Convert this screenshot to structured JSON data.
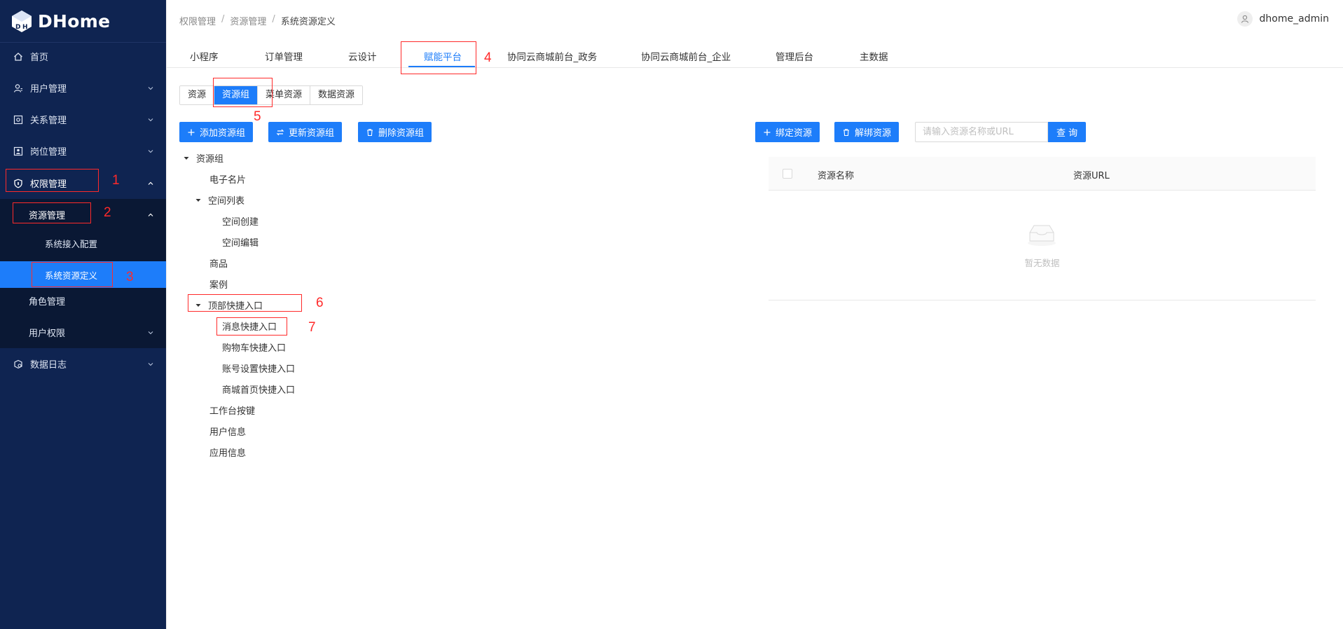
{
  "app": {
    "brand": "DHome"
  },
  "sidebar": {
    "items": [
      {
        "label": "首页",
        "icon": "home-icon"
      },
      {
        "label": "用户管理",
        "icon": "user-icon"
      },
      {
        "label": "关系管理",
        "icon": "relation-icon"
      },
      {
        "label": "岗位管理",
        "icon": "post-icon"
      },
      {
        "label": "权限管理",
        "icon": "shield-icon"
      },
      {
        "label": "资源管理"
      },
      {
        "label": "系统接入配置"
      },
      {
        "label": "系统资源定义"
      },
      {
        "label": "角色管理"
      },
      {
        "label": "用户权限"
      },
      {
        "label": "数据日志",
        "icon": "data-log-icon"
      }
    ]
  },
  "breadcrumb": [
    "权限管理",
    "资源管理",
    "系统资源定义"
  ],
  "user": {
    "name": "dhome_admin"
  },
  "tabs": [
    "小程序",
    "订单管理",
    "云设计",
    "赋能平台",
    "协同云商城前台_政务",
    "协同云商城前台_企业",
    "管理后台",
    "主数据"
  ],
  "segments": [
    "资源",
    "资源组",
    "菜单资源",
    "数据资源"
  ],
  "buttons": {
    "add_group": "添加资源组",
    "update_group": "更新资源组",
    "delete_group": "删除资源组",
    "bind": "绑定资源",
    "unbind": "解绑资源",
    "query": "查 询"
  },
  "search": {
    "placeholder": "请输入资源名称或URL",
    "value": ""
  },
  "tree": [
    "资源组",
    "电子名片",
    "空间列表",
    "空间创建",
    "空间编辑",
    "商品",
    "案例",
    "顶部快捷入口",
    "消息快捷入口",
    "购物车快捷入口",
    "账号设置快捷入口",
    "商城首页快捷入口",
    "工作台按键",
    "用户信息",
    "应用信息"
  ],
  "table": {
    "columns": [
      "资源名称",
      "资源URL"
    ],
    "empty_text": "暂无数据"
  },
  "annotations": [
    "1",
    "2",
    "3",
    "4",
    "5",
    "6",
    "7"
  ],
  "colors": {
    "sidebar_bg": "#0f2451",
    "accent": "#1d7dfa",
    "annotation": "#ff2a2a"
  }
}
